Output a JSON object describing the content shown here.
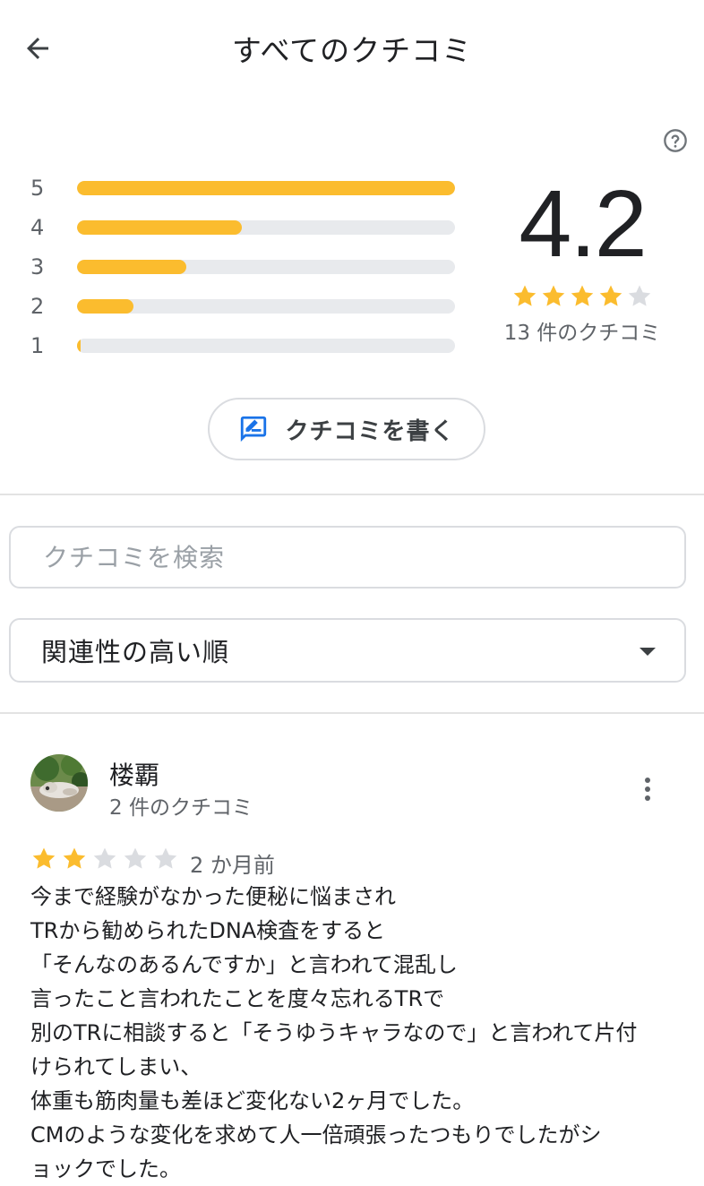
{
  "header": {
    "title": "すべてのクチコミ"
  },
  "summary": {
    "score": "4.2",
    "stars_filled": 4,
    "stars_total": 5,
    "count_label": "13 件のクチコミ",
    "distribution": [
      {
        "label": "5",
        "fraction": 1.0
      },
      {
        "label": "4",
        "fraction": 0.435
      },
      {
        "label": "3",
        "fraction": 0.29
      },
      {
        "label": "2",
        "fraction": 0.15
      },
      {
        "label": "1",
        "fraction": 0.01
      }
    ]
  },
  "write_button": {
    "label": "クチコミを書く"
  },
  "search": {
    "placeholder": "クチコミを検索",
    "value": ""
  },
  "sort": {
    "selected": "関連性の高い順"
  },
  "reviews": [
    {
      "name": "楼覇",
      "review_count": "2 件のクチコミ",
      "rating": 2,
      "date": "2 か月前",
      "lines": [
        "今まで経験がなかった便秘に悩まされ",
        "TRから勧められたDNA検査をすると",
        "「そんなのあるんですか」と言われて混乱し",
        "言ったこと言われたことを度々忘れるTRで",
        "別のTRに相談すると「そうゆうキャラなので」と言われて片付",
        "けられてしまい、",
        "体重も筋肉量も差ほど変化ない2ヶ月でした。",
        "CMのような変化を求めて人一倍頑張ったつもりでしたがシ",
        "ョックでした。"
      ]
    }
  ],
  "colors": {
    "star": "#fbbc2e",
    "star_empty": "#dadce0",
    "bar_track": "#e8eaed",
    "accent": "#1a73e8"
  },
  "icons": {
    "back": "arrow-left-icon",
    "help": "question-circle-icon",
    "write": "rate-review-icon",
    "more": "more-vert-icon",
    "dropdown": "caret-down-icon"
  }
}
